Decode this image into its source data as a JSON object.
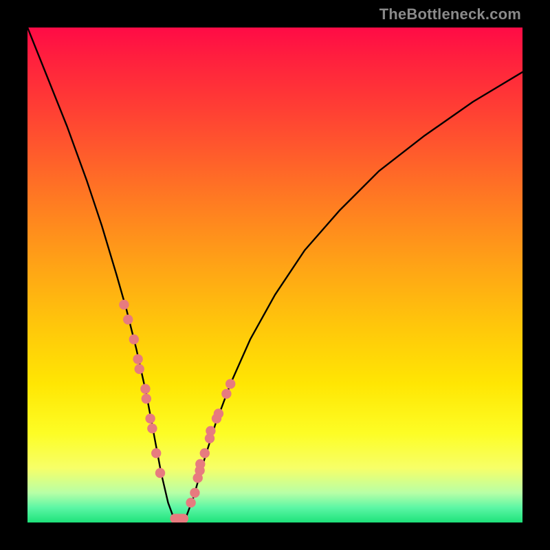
{
  "attribution": "TheBottleneck.com",
  "chart_data": {
    "type": "line",
    "title": "",
    "xlabel": "",
    "ylabel": "",
    "xlim": [
      0,
      100
    ],
    "ylim": [
      0,
      100
    ],
    "curve": {
      "name": "bottleneck-curve",
      "x": [
        0,
        4,
        8,
        12,
        15,
        18,
        20,
        22,
        24,
        25.5,
        27,
        28.4,
        29.5,
        30.4,
        31,
        32,
        33.5,
        35.5,
        38,
        41,
        45,
        50,
        56,
        63,
        71,
        80,
        90,
        100
      ],
      "y": [
        100,
        90,
        80,
        69,
        60,
        50,
        43,
        35,
        26,
        18,
        10,
        4,
        1,
        0,
        0,
        1,
        5,
        12,
        20,
        28,
        37,
        46,
        55,
        63,
        71,
        78,
        85,
        91
      ]
    },
    "dots_left": {
      "name": "left-cluster",
      "color": "#e77b7f",
      "points": [
        {
          "x": 19.5,
          "y": 44
        },
        {
          "x": 20.3,
          "y": 41
        },
        {
          "x": 21.5,
          "y": 37
        },
        {
          "x": 22.3,
          "y": 33
        },
        {
          "x": 22.6,
          "y": 31
        },
        {
          "x": 23.8,
          "y": 27
        },
        {
          "x": 24.0,
          "y": 25
        },
        {
          "x": 24.8,
          "y": 21
        },
        {
          "x": 25.2,
          "y": 19
        },
        {
          "x": 26.0,
          "y": 14
        },
        {
          "x": 26.8,
          "y": 10
        }
      ]
    },
    "dots_right": {
      "name": "right-cluster",
      "color": "#e77b7f",
      "points": [
        {
          "x": 33.0,
          "y": 4
        },
        {
          "x": 33.8,
          "y": 6
        },
        {
          "x": 34.4,
          "y": 9
        },
        {
          "x": 34.8,
          "y": 10.5
        },
        {
          "x": 34.9,
          "y": 11.8
        },
        {
          "x": 35.8,
          "y": 14
        },
        {
          "x": 36.8,
          "y": 17
        },
        {
          "x": 37.0,
          "y": 18.5
        },
        {
          "x": 38.2,
          "y": 21
        },
        {
          "x": 38.6,
          "y": 22
        },
        {
          "x": 40.2,
          "y": 26
        },
        {
          "x": 41.0,
          "y": 28
        }
      ]
    },
    "trough_bar": {
      "name": "trough-marker",
      "color": "#e77b7f",
      "x1": 28.8,
      "x2": 32.5,
      "y": 0.8,
      "thickness": 1.9
    }
  }
}
